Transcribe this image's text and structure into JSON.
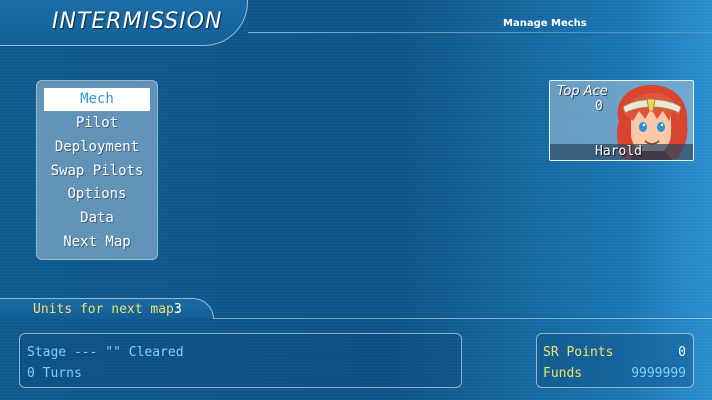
{
  "header": {
    "title": "INTERMISSION",
    "subtitle": "Manage Mechs"
  },
  "menu": {
    "items": [
      {
        "label": "Mech",
        "selected": true
      },
      {
        "label": "Pilot",
        "selected": false
      },
      {
        "label": "Deployment",
        "selected": false
      },
      {
        "label": "Swap Pilots",
        "selected": false
      },
      {
        "label": "Options",
        "selected": false
      },
      {
        "label": "Data",
        "selected": false
      },
      {
        "label": "Next Map",
        "selected": false
      }
    ]
  },
  "top_ace": {
    "label": "Top Ace",
    "kills": "0",
    "name": "Harold"
  },
  "units": {
    "label": "Units for next map:",
    "value": "3"
  },
  "stage": {
    "status": "Stage --- \"\" Cleared",
    "turns": "0 Turns"
  },
  "points": {
    "sr_label": "SR Points",
    "sr_value": "0",
    "funds_label": "Funds",
    "funds_value": "9999999"
  },
  "colors": {
    "label_yellow": "#f3e06a",
    "value_cyan": "#7fd0ff",
    "menu_selected_text": "#2b9ad6"
  },
  "icons": [
    "pilot-portrait-harold"
  ]
}
